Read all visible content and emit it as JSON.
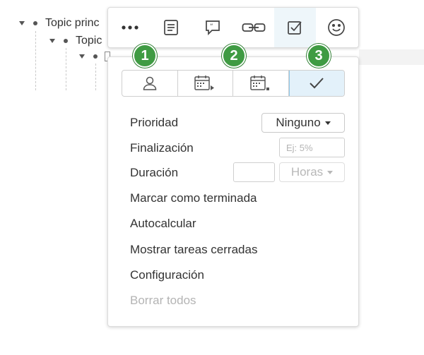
{
  "outline": {
    "topic_main": "Topic princ",
    "topic_sub": "Topic"
  },
  "toolbar": {
    "items": [
      {
        "icon": "more-icon"
      },
      {
        "icon": "note-icon"
      },
      {
        "icon": "comment-icon"
      },
      {
        "icon": "link-icon"
      },
      {
        "icon": "task-icon",
        "active": true
      },
      {
        "icon": "emoji-icon"
      }
    ]
  },
  "badges": [
    "1",
    "2",
    "3"
  ],
  "task_tabs": [
    {
      "icon": "user-icon"
    },
    {
      "icon": "start-date-icon"
    },
    {
      "icon": "due-date-icon"
    },
    {
      "icon": "checkmark-icon",
      "active": true
    }
  ],
  "task_panel": {
    "priority_label": "Prioridad",
    "priority_value": "Ninguno",
    "completion_label": "Finalización",
    "completion_placeholder": "Ej: 5%",
    "duration_label": "Duración",
    "duration_value": "",
    "duration_unit": "Horas",
    "mark_done": "Marcar como terminada",
    "auto_calc": "Autocalcular",
    "show_closed": "Mostrar tareas cerradas",
    "settings": "Configuración",
    "clear_all": "Borrar todos"
  },
  "colors": {
    "badge_green": "#3f9b43",
    "active_tab_bg": "#e3f1fa",
    "toolbar_active_bg": "#eef6fa"
  }
}
